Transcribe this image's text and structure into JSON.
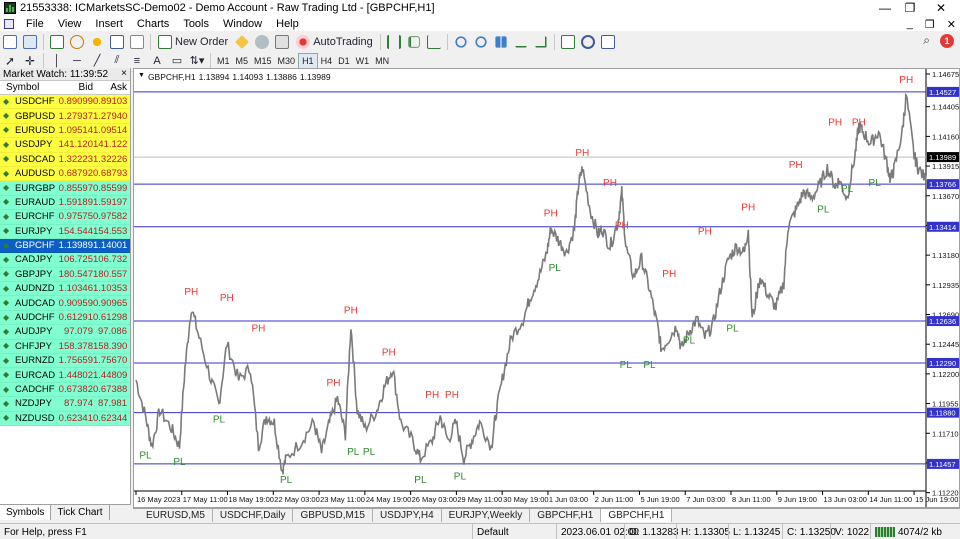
{
  "window": {
    "title": "21553338: ICMarketsSC-Demo02 - Demo Account - Raw Trading Ltd - [GBPCHF,H1]",
    "minimize": "—",
    "maximize": "❐",
    "close": "✕"
  },
  "menu": {
    "items": [
      "File",
      "View",
      "Insert",
      "Charts",
      "Tools",
      "Window",
      "Help"
    ],
    "right_min": "_",
    "right_restore": "❐",
    "right_close": "✕"
  },
  "toolbar": {
    "new_order_label": "New Order",
    "autotrading_label": "AutoTrading",
    "timeframes": [
      "M1",
      "M5",
      "M15",
      "M30",
      "H1",
      "H4",
      "D1",
      "W1",
      "MN"
    ],
    "active_timeframe": "H1",
    "notification_count": "1"
  },
  "market_watch": {
    "header": "Market Watch: 11:39:52",
    "close": "×",
    "col_symbol": "Symbol",
    "col_bid": "Bid",
    "col_ask": "Ask",
    "rows": [
      {
        "symbol": "USDCHF",
        "bid": "0.89099",
        "ask": "0.89103",
        "color": "#ffff40"
      },
      {
        "symbol": "GBPUSD",
        "bid": "1.27937",
        "ask": "1.27940",
        "color": "#ffff40"
      },
      {
        "symbol": "EURUSD",
        "bid": "1.09514",
        "ask": "1.09514",
        "color": "#ffff40"
      },
      {
        "symbol": "USDJPY",
        "bid": "141.120",
        "ask": "141.122",
        "color": "#ffff40"
      },
      {
        "symbol": "USDCAD",
        "bid": "1.32223",
        "ask": "1.32226",
        "color": "#ffff40"
      },
      {
        "symbol": "AUDUSD",
        "bid": "0.68792",
        "ask": "0.68793",
        "color": "#ffff40"
      },
      {
        "symbol": "EURGBP",
        "bid": "0.85597",
        "ask": "0.85599",
        "color": "#80ffd0"
      },
      {
        "symbol": "EURAUD",
        "bid": "1.59189",
        "ask": "1.59197",
        "color": "#80ffd0"
      },
      {
        "symbol": "EURCHF",
        "bid": "0.97575",
        "ask": "0.97582",
        "color": "#80ffd0"
      },
      {
        "symbol": "EURJPY",
        "bid": "154.544",
        "ask": "154.553",
        "color": "#80ffd0"
      },
      {
        "symbol": "GBPCHF",
        "bid": "1.13989",
        "ask": "1.14001",
        "color": "#0b5fc4",
        "selected": true
      },
      {
        "symbol": "CADJPY",
        "bid": "106.725",
        "ask": "106.732",
        "color": "#80ffd0"
      },
      {
        "symbol": "GBPJPY",
        "bid": "180.547",
        "ask": "180.557",
        "color": "#80ffd0"
      },
      {
        "symbol": "AUDNZD",
        "bid": "1.10346",
        "ask": "1.10353",
        "color": "#80ffd0"
      },
      {
        "symbol": "AUDCAD",
        "bid": "0.90959",
        "ask": "0.90965",
        "color": "#80ffd0"
      },
      {
        "symbol": "AUDCHF",
        "bid": "0.61291",
        "ask": "0.61298",
        "color": "#80ffd0"
      },
      {
        "symbol": "AUDJPY",
        "bid": "97.079",
        "ask": "97.086",
        "color": "#80ffd0"
      },
      {
        "symbol": "CHFJPY",
        "bid": "158.378",
        "ask": "158.390",
        "color": "#80ffd0"
      },
      {
        "symbol": "EURNZD",
        "bid": "1.75659",
        "ask": "1.75670",
        "color": "#80ffd0"
      },
      {
        "symbol": "EURCAD",
        "bid": "1.44802",
        "ask": "1.44809",
        "color": "#80ffd0"
      },
      {
        "symbol": "CADCHF",
        "bid": "0.67382",
        "ask": "0.67388",
        "color": "#80ffd0"
      },
      {
        "symbol": "NZDJPY",
        "bid": "87.974",
        "ask": "87.981",
        "color": "#80ffd0"
      },
      {
        "symbol": "NZDUSD",
        "bid": "0.62341",
        "ask": "0.62344",
        "color": "#80ffd0"
      }
    ],
    "tabs": [
      "Symbols",
      "Tick Chart"
    ],
    "active_tab": "Symbols"
  },
  "chart": {
    "info": [
      "GBPCHF,H1",
      "1.13894",
      "1.14093",
      "1.13886",
      "1.13989"
    ]
  },
  "chart_data": {
    "type": "line",
    "symbol": "GBPCHF",
    "timeframe": "H1",
    "ylim": [
      1.1125,
      1.1465
    ],
    "y_ticks": [
      "1.14675",
      "1.14405",
      "1.14160",
      "1.13915",
      "1.13670",
      "1.13425",
      "1.13180",
      "1.12935",
      "1.12690",
      "1.12445",
      "1.12200",
      "1.11955",
      "1.11710",
      "1.11465",
      "1.11220"
    ],
    "x_ticks": [
      "16 May 2023",
      "17 May 11:00",
      "18 May 19:00",
      "22 May 03:00",
      "23 May 11:00",
      "24 May 19:00",
      "26 May 03:00",
      "29 May 11:00",
      "30 May 19:00",
      "1 Jun 03:00",
      "2 Jun 11:00",
      "5 Jun 19:00",
      "7 Jun 03:00",
      "8 Jun 11:00",
      "9 Jun 19:00",
      "13 Jun 03:00",
      "14 Jun 11:00",
      "15 Jun 19:00"
    ],
    "levels": [
      {
        "value": 1.14527,
        "label": "1.14527"
      },
      {
        "value": 1.13766,
        "label": "1.13766"
      },
      {
        "value": 1.13414,
        "label": "1.13414"
      },
      {
        "value": 1.12636,
        "label": "1.12636"
      },
      {
        "value": 1.1229,
        "label": "1.12290"
      },
      {
        "value": 1.1188,
        "label": "1.11880"
      },
      {
        "value": 1.11457,
        "label": "1.11457"
      }
    ],
    "current_price": {
      "value": 1.13989,
      "label": "1.13989"
    },
    "price_path": [
      [
        0.0,
        1.1215
      ],
      [
        0.012,
        1.1185
      ],
      [
        0.02,
        1.116
      ],
      [
        0.03,
        1.119
      ],
      [
        0.045,
        1.1175
      ],
      [
        0.055,
        1.116
      ],
      [
        0.062,
        1.1225
      ],
      [
        0.07,
        1.1275
      ],
      [
        0.08,
        1.125
      ],
      [
        0.095,
        1.1215
      ],
      [
        0.105,
        1.1195
      ],
      [
        0.115,
        1.1245
      ],
      [
        0.13,
        1.1215
      ],
      [
        0.145,
        1.1225
      ],
      [
        0.155,
        1.116
      ],
      [
        0.165,
        1.1185
      ],
      [
        0.175,
        1.118
      ],
      [
        0.185,
        1.114
      ],
      [
        0.19,
        1.115
      ],
      [
        0.21,
        1.1165
      ],
      [
        0.225,
        1.118
      ],
      [
        0.235,
        1.1155
      ],
      [
        0.245,
        1.118
      ],
      [
        0.255,
        1.12
      ],
      [
        0.265,
        1.117
      ],
      [
        0.272,
        1.126
      ],
      [
        0.28,
        1.119
      ],
      [
        0.29,
        1.1175
      ],
      [
        0.305,
        1.119
      ],
      [
        0.315,
        1.121
      ],
      [
        0.325,
        1.1225
      ],
      [
        0.335,
        1.118
      ],
      [
        0.35,
        1.1165
      ],
      [
        0.36,
        1.115
      ],
      [
        0.375,
        1.1165
      ],
      [
        0.385,
        1.1185
      ],
      [
        0.395,
        1.1165
      ],
      [
        0.405,
        1.118
      ],
      [
        0.415,
        1.115
      ],
      [
        0.425,
        1.1165
      ],
      [
        0.435,
        1.118
      ],
      [
        0.45,
        1.116
      ],
      [
        0.455,
        1.1185
      ],
      [
        0.465,
        1.122
      ],
      [
        0.475,
        1.125
      ],
      [
        0.49,
        1.1265
      ],
      [
        0.5,
        1.1285
      ],
      [
        0.51,
        1.13
      ],
      [
        0.52,
        1.132
      ],
      [
        0.525,
        1.134
      ],
      [
        0.535,
        1.133
      ],
      [
        0.545,
        1.132
      ],
      [
        0.555,
        1.134
      ],
      [
        0.56,
        1.1375
      ],
      [
        0.565,
        1.139
      ],
      [
        0.575,
        1.1355
      ],
      [
        0.585,
        1.1335
      ],
      [
        0.59,
        1.134
      ],
      [
        0.6,
        1.1325
      ],
      [
        0.61,
        1.1345
      ],
      [
        0.615,
        1.137
      ],
      [
        0.62,
        1.1325
      ],
      [
        0.63,
        1.13
      ],
      [
        0.64,
        1.1315
      ],
      [
        0.65,
        1.129
      ],
      [
        0.66,
        1.126
      ],
      [
        0.665,
        1.124
      ],
      [
        0.675,
        1.125
      ],
      [
        0.685,
        1.126
      ],
      [
        0.69,
        1.124
      ],
      [
        0.7,
        1.1255
      ],
      [
        0.71,
        1.1265
      ],
      [
        0.72,
        1.125
      ],
      [
        0.73,
        1.126
      ],
      [
        0.74,
        1.129
      ],
      [
        0.75,
        1.1315
      ],
      [
        0.76,
        1.1325
      ],
      [
        0.77,
        1.132
      ],
      [
        0.775,
        1.134
      ],
      [
        0.78,
        1.1265
      ],
      [
        0.79,
        1.13
      ],
      [
        0.8,
        1.1285
      ],
      [
        0.81,
        1.1275
      ],
      [
        0.82,
        1.1295
      ],
      [
        0.825,
        1.134
      ],
      [
        0.835,
        1.1355
      ],
      [
        0.845,
        1.137
      ],
      [
        0.855,
        1.1365
      ],
      [
        0.865,
        1.1375
      ],
      [
        0.875,
        1.139
      ],
      [
        0.885,
        1.1375
      ],
      [
        0.89,
        1.138
      ],
      [
        0.9,
        1.1365
      ],
      [
        0.91,
        1.14
      ],
      [
        0.915,
        1.1425
      ],
      [
        0.92,
        1.142
      ],
      [
        0.93,
        1.141
      ],
      [
        0.94,
        1.142
      ],
      [
        0.95,
        1.1395
      ],
      [
        0.955,
        1.138
      ],
      [
        0.96,
        1.139
      ],
      [
        0.97,
        1.142
      ],
      [
        0.975,
        1.145
      ],
      [
        0.985,
        1.14
      ],
      [
        0.99,
        1.139
      ],
      [
        1.0,
        1.138
      ]
    ],
    "annotations": [
      {
        "text": "PH",
        "x": 0.07,
        "y": 1.1285
      },
      {
        "text": "PH",
        "x": 0.115,
        "y": 1.128
      },
      {
        "text": "PH",
        "x": 0.155,
        "y": 1.1255
      },
      {
        "text": "PH",
        "x": 0.272,
        "y": 1.127
      },
      {
        "text": "PH",
        "x": 0.32,
        "y": 1.1235
      },
      {
        "text": "PH",
        "x": 0.25,
        "y": 1.121
      },
      {
        "text": "PH",
        "x": 0.375,
        "y": 1.12
      },
      {
        "text": "PH",
        "x": 0.4,
        "y": 1.12
      },
      {
        "text": "PH",
        "x": 0.525,
        "y": 1.135
      },
      {
        "text": "PH",
        "x": 0.565,
        "y": 1.14
      },
      {
        "text": "PH",
        "x": 0.6,
        "y": 1.1375
      },
      {
        "text": "PH",
        "x": 0.615,
        "y": 1.134
      },
      {
        "text": "PH",
        "x": 0.675,
        "y": 1.13
      },
      {
        "text": "PH",
        "x": 0.72,
        "y": 1.1335
      },
      {
        "text": "PH",
        "x": 0.775,
        "y": 1.1355
      },
      {
        "text": "PH",
        "x": 0.835,
        "y": 1.139
      },
      {
        "text": "PH",
        "x": 0.885,
        "y": 1.1425
      },
      {
        "text": "PH",
        "x": 0.915,
        "y": 1.1425
      },
      {
        "text": "PH",
        "x": 0.975,
        "y": 1.146
      },
      {
        "text": "PL",
        "x": 0.012,
        "y": 1.115
      },
      {
        "text": "PL",
        "x": 0.055,
        "y": 1.1145
      },
      {
        "text": "PL",
        "x": 0.105,
        "y": 1.118
      },
      {
        "text": "PL",
        "x": 0.19,
        "y": 1.113
      },
      {
        "text": "PL",
        "x": 0.275,
        "y": 1.1153
      },
      {
        "text": "PL",
        "x": 0.295,
        "y": 1.1153
      },
      {
        "text": "PL",
        "x": 0.36,
        "y": 1.113
      },
      {
        "text": "PL",
        "x": 0.41,
        "y": 1.1133
      },
      {
        "text": "PL",
        "x": 0.53,
        "y": 1.1305
      },
      {
        "text": "PL",
        "x": 0.62,
        "y": 1.1225
      },
      {
        "text": "PL",
        "x": 0.65,
        "y": 1.1225
      },
      {
        "text": "PL",
        "x": 0.7,
        "y": 1.1245
      },
      {
        "text": "PL",
        "x": 0.755,
        "y": 1.1255
      },
      {
        "text": "PL",
        "x": 0.87,
        "y": 1.1353
      },
      {
        "text": "PL",
        "x": 0.9,
        "y": 1.137
      },
      {
        "text": "PL",
        "x": 0.935,
        "y": 1.1375
      }
    ],
    "colors": {
      "ph": "#e53935",
      "pl": "#2e8b2e",
      "level": "#3333cc",
      "price": "#7a7a7a",
      "current_bg": "#000000"
    }
  },
  "chart_tabs": [
    "EURUSD,M5",
    "USDCHF,Daily",
    "GBPUSD,M15",
    "USDJPY,H4",
    "EURJPY,Weekly",
    "GBPCHF,H1",
    "GBPCHF,H1"
  ],
  "active_chart_tab": 6,
  "status": {
    "help": "For Help, press F1",
    "profile": "Default",
    "time": "2023.06.01 02:00",
    "open": "O: 1.13283",
    "high": "H: 1.13305",
    "low": "L: 1.13245",
    "close": "C: 1.13250",
    "volume": "V: 1022",
    "traffic": "4074/2 kb"
  }
}
